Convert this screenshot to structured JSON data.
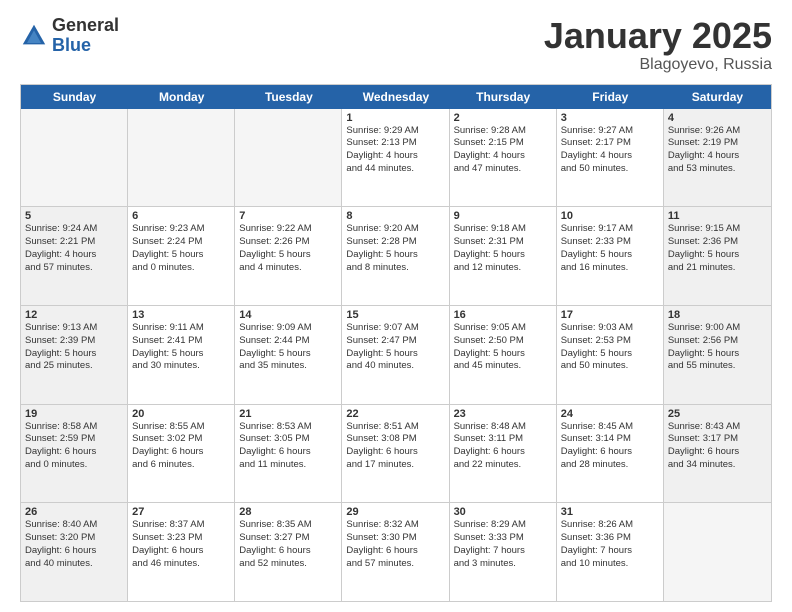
{
  "header": {
    "logo_general": "General",
    "logo_blue": "Blue",
    "month_title": "January 2025",
    "location": "Blagoyevo, Russia"
  },
  "weekdays": [
    "Sunday",
    "Monday",
    "Tuesday",
    "Wednesday",
    "Thursday",
    "Friday",
    "Saturday"
  ],
  "rows": [
    [
      {
        "day": "",
        "text": "",
        "empty": true
      },
      {
        "day": "",
        "text": "",
        "empty": true
      },
      {
        "day": "",
        "text": "",
        "empty": true
      },
      {
        "day": "1",
        "text": "Sunrise: 9:29 AM\nSunset: 2:13 PM\nDaylight: 4 hours\nand 44 minutes.",
        "empty": false,
        "shaded": false
      },
      {
        "day": "2",
        "text": "Sunrise: 9:28 AM\nSunset: 2:15 PM\nDaylight: 4 hours\nand 47 minutes.",
        "empty": false,
        "shaded": false
      },
      {
        "day": "3",
        "text": "Sunrise: 9:27 AM\nSunset: 2:17 PM\nDaylight: 4 hours\nand 50 minutes.",
        "empty": false,
        "shaded": false
      },
      {
        "day": "4",
        "text": "Sunrise: 9:26 AM\nSunset: 2:19 PM\nDaylight: 4 hours\nand 53 minutes.",
        "empty": false,
        "shaded": true
      }
    ],
    [
      {
        "day": "5",
        "text": "Sunrise: 9:24 AM\nSunset: 2:21 PM\nDaylight: 4 hours\nand 57 minutes.",
        "empty": false,
        "shaded": true
      },
      {
        "day": "6",
        "text": "Sunrise: 9:23 AM\nSunset: 2:24 PM\nDaylight: 5 hours\nand 0 minutes.",
        "empty": false,
        "shaded": false
      },
      {
        "day": "7",
        "text": "Sunrise: 9:22 AM\nSunset: 2:26 PM\nDaylight: 5 hours\nand 4 minutes.",
        "empty": false,
        "shaded": false
      },
      {
        "day": "8",
        "text": "Sunrise: 9:20 AM\nSunset: 2:28 PM\nDaylight: 5 hours\nand 8 minutes.",
        "empty": false,
        "shaded": false
      },
      {
        "day": "9",
        "text": "Sunrise: 9:18 AM\nSunset: 2:31 PM\nDaylight: 5 hours\nand 12 minutes.",
        "empty": false,
        "shaded": false
      },
      {
        "day": "10",
        "text": "Sunrise: 9:17 AM\nSunset: 2:33 PM\nDaylight: 5 hours\nand 16 minutes.",
        "empty": false,
        "shaded": false
      },
      {
        "day": "11",
        "text": "Sunrise: 9:15 AM\nSunset: 2:36 PM\nDaylight: 5 hours\nand 21 minutes.",
        "empty": false,
        "shaded": true
      }
    ],
    [
      {
        "day": "12",
        "text": "Sunrise: 9:13 AM\nSunset: 2:39 PM\nDaylight: 5 hours\nand 25 minutes.",
        "empty": false,
        "shaded": true
      },
      {
        "day": "13",
        "text": "Sunrise: 9:11 AM\nSunset: 2:41 PM\nDaylight: 5 hours\nand 30 minutes.",
        "empty": false,
        "shaded": false
      },
      {
        "day": "14",
        "text": "Sunrise: 9:09 AM\nSunset: 2:44 PM\nDaylight: 5 hours\nand 35 minutes.",
        "empty": false,
        "shaded": false
      },
      {
        "day": "15",
        "text": "Sunrise: 9:07 AM\nSunset: 2:47 PM\nDaylight: 5 hours\nand 40 minutes.",
        "empty": false,
        "shaded": false
      },
      {
        "day": "16",
        "text": "Sunrise: 9:05 AM\nSunset: 2:50 PM\nDaylight: 5 hours\nand 45 minutes.",
        "empty": false,
        "shaded": false
      },
      {
        "day": "17",
        "text": "Sunrise: 9:03 AM\nSunset: 2:53 PM\nDaylight: 5 hours\nand 50 minutes.",
        "empty": false,
        "shaded": false
      },
      {
        "day": "18",
        "text": "Sunrise: 9:00 AM\nSunset: 2:56 PM\nDaylight: 5 hours\nand 55 minutes.",
        "empty": false,
        "shaded": true
      }
    ],
    [
      {
        "day": "19",
        "text": "Sunrise: 8:58 AM\nSunset: 2:59 PM\nDaylight: 6 hours\nand 0 minutes.",
        "empty": false,
        "shaded": true
      },
      {
        "day": "20",
        "text": "Sunrise: 8:55 AM\nSunset: 3:02 PM\nDaylight: 6 hours\nand 6 minutes.",
        "empty": false,
        "shaded": false
      },
      {
        "day": "21",
        "text": "Sunrise: 8:53 AM\nSunset: 3:05 PM\nDaylight: 6 hours\nand 11 minutes.",
        "empty": false,
        "shaded": false
      },
      {
        "day": "22",
        "text": "Sunrise: 8:51 AM\nSunset: 3:08 PM\nDaylight: 6 hours\nand 17 minutes.",
        "empty": false,
        "shaded": false
      },
      {
        "day": "23",
        "text": "Sunrise: 8:48 AM\nSunset: 3:11 PM\nDaylight: 6 hours\nand 22 minutes.",
        "empty": false,
        "shaded": false
      },
      {
        "day": "24",
        "text": "Sunrise: 8:45 AM\nSunset: 3:14 PM\nDaylight: 6 hours\nand 28 minutes.",
        "empty": false,
        "shaded": false
      },
      {
        "day": "25",
        "text": "Sunrise: 8:43 AM\nSunset: 3:17 PM\nDaylight: 6 hours\nand 34 minutes.",
        "empty": false,
        "shaded": true
      }
    ],
    [
      {
        "day": "26",
        "text": "Sunrise: 8:40 AM\nSunset: 3:20 PM\nDaylight: 6 hours\nand 40 minutes.",
        "empty": false,
        "shaded": true
      },
      {
        "day": "27",
        "text": "Sunrise: 8:37 AM\nSunset: 3:23 PM\nDaylight: 6 hours\nand 46 minutes.",
        "empty": false,
        "shaded": false
      },
      {
        "day": "28",
        "text": "Sunrise: 8:35 AM\nSunset: 3:27 PM\nDaylight: 6 hours\nand 52 minutes.",
        "empty": false,
        "shaded": false
      },
      {
        "day": "29",
        "text": "Sunrise: 8:32 AM\nSunset: 3:30 PM\nDaylight: 6 hours\nand 57 minutes.",
        "empty": false,
        "shaded": false
      },
      {
        "day": "30",
        "text": "Sunrise: 8:29 AM\nSunset: 3:33 PM\nDaylight: 7 hours\nand 3 minutes.",
        "empty": false,
        "shaded": false
      },
      {
        "day": "31",
        "text": "Sunrise: 8:26 AM\nSunset: 3:36 PM\nDaylight: 7 hours\nand 10 minutes.",
        "empty": false,
        "shaded": false
      },
      {
        "day": "",
        "text": "",
        "empty": true,
        "shaded": true
      }
    ]
  ]
}
